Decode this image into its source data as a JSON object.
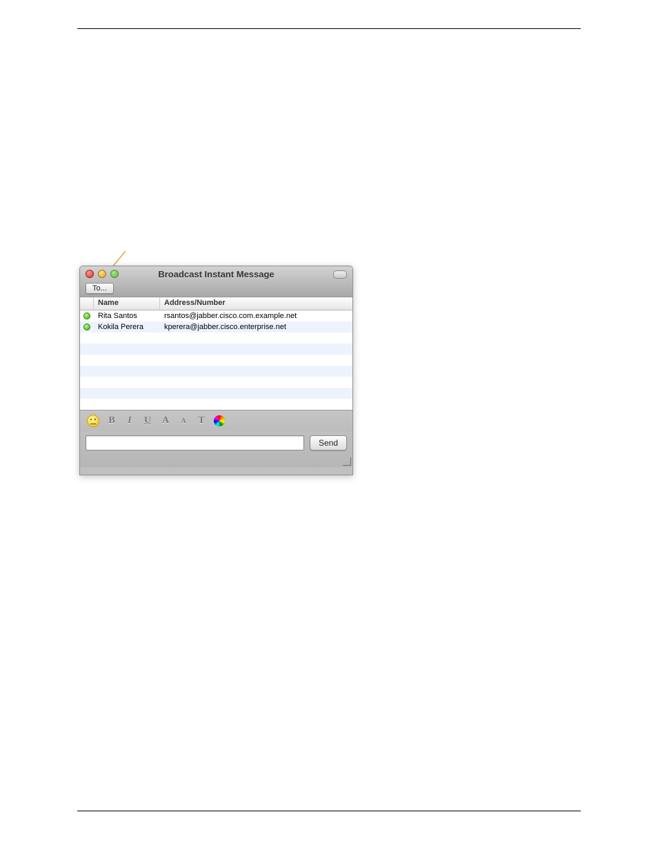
{
  "window": {
    "title": "Broadcast Instant Message",
    "to_button_label": "To..."
  },
  "table": {
    "headers": {
      "name": "Name",
      "address": "Address/Number"
    },
    "rows": [
      {
        "status": "available",
        "name": "Rita Santos",
        "address": "rsantos@jabber.cisco.com.example.net"
      },
      {
        "status": "available",
        "name": "Kokila Perera",
        "address": "kperera@jabber.cisco.enterprise.net"
      }
    ]
  },
  "format_bar": {
    "emoticon_icon": "emoticon",
    "bold": "B",
    "italic": "I",
    "underline": "U",
    "font_bigger": "A",
    "font_smaller": "A",
    "font_face": "T",
    "color_icon": "color-wheel"
  },
  "compose": {
    "placeholder": "",
    "value": "",
    "send_label": "Send"
  }
}
